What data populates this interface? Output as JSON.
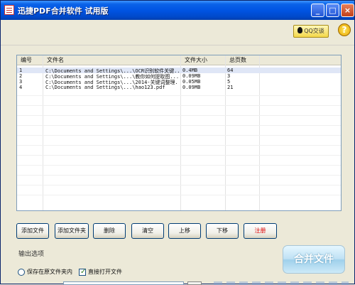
{
  "window": {
    "title": "迅捷PDF合并软件 试用版"
  },
  "toolbar": {
    "qq_label": "QQ交谈",
    "help_label": "?"
  },
  "list": {
    "columns": [
      "编号",
      "文件名",
      "文件大小",
      "总页数"
    ],
    "rows": [
      {
        "index": "1",
        "filename": "C:\\Documents and Settings\\...\\OCR识别软件关键...",
        "size": "0.4MB",
        "pages": "64"
      },
      {
        "index": "2",
        "filename": "C:\\Documents and Settings\\...\\教你如何提取图...",
        "size": "0.09MB",
        "pages": "3"
      },
      {
        "index": "3",
        "filename": "C:\\Documents and Settings\\...\\2014-关键词整理...",
        "size": "0.05MB",
        "pages": "5"
      },
      {
        "index": "4",
        "filename": "C:\\Documents and Settings\\...\\hao123.pdf",
        "size": "0.09MB",
        "pages": "21"
      }
    ]
  },
  "actions": {
    "add_file": "添加文件",
    "add_folder": "添加文件夹",
    "delete": "删除",
    "clear": "清空",
    "move_up": "上移",
    "move_down": "下移",
    "register": "注册"
  },
  "output": {
    "section_label": "输出选项",
    "save_original_folder": "保存在原文件夹内",
    "open_directory": "直接打开文件",
    "merge_button": "合并文件"
  },
  "colors": {
    "titlebar": "#0054e3",
    "register": "#dd0000",
    "merge_button": "#bfe1f4"
  },
  "icons": {
    "app": "pdf-app-icon",
    "qq": "qq-icon",
    "help": "help-icon"
  }
}
